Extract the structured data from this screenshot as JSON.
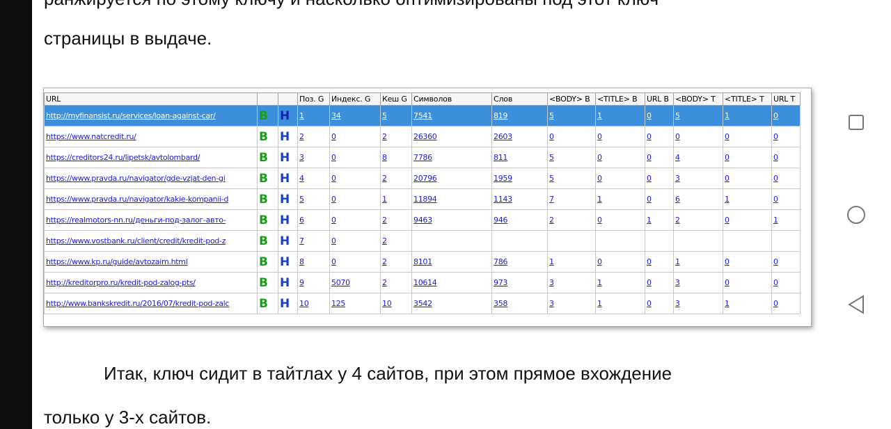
{
  "article": {
    "cut_line": "ранжируется по этому ключу и насколько оптимизированы под этот ключ",
    "line2": "страницы в выдаче.",
    "line3": "Итак, ключ сидит в тайтлах у 4 сайтов, при этом прямое вхождение",
    "line4": "только у 3-х сайтов."
  },
  "table": {
    "headers": [
      "URL",
      "",
      "",
      "Поз. G",
      "Индекс. G",
      "Кеш G",
      "Символов",
      "Слов",
      "<BODY> B",
      "<TITLE> B",
      "URL B",
      "<BODY> T",
      "<TITLE> T",
      "URL T"
    ],
    "yandex_label": "B",
    "google_label": "H",
    "rows": [
      {
        "url": "http://myfinansist.ru/services/loan-against-car/",
        "pos": "1",
        "idx": "34",
        "cache": "5",
        "chars": "7541",
        "words": "819",
        "body_b": "5",
        "title_b": "1",
        "url_b": "0",
        "body_t": "5",
        "title_t": "1",
        "url_t": "0"
      },
      {
        "url": "https://www.natcredit.ru/",
        "pos": "2",
        "idx": "0",
        "cache": "2",
        "chars": "26360",
        "words": "2603",
        "body_b": "0",
        "title_b": "0",
        "url_b": "0",
        "body_t": "0",
        "title_t": "0",
        "url_t": "0"
      },
      {
        "url": "https://creditors24.ru/lipetsk/avtolombard/",
        "pos": "3",
        "idx": "0",
        "cache": "8",
        "chars": "7786",
        "words": "811",
        "body_b": "5",
        "title_b": "0",
        "url_b": "0",
        "body_t": "4",
        "title_t": "0",
        "url_t": "0"
      },
      {
        "url": "https://www.pravda.ru/navigator/gde-vzjat-den-gi",
        "pos": "4",
        "idx": "0",
        "cache": "2",
        "chars": "20796",
        "words": "1959",
        "body_b": "5",
        "title_b": "0",
        "url_b": "0",
        "body_t": "3",
        "title_t": "0",
        "url_t": "0"
      },
      {
        "url": "https://www.pravda.ru/navigator/kakie-kompanii-d",
        "pos": "5",
        "idx": "0",
        "cache": "1",
        "chars": "11894",
        "words": "1143",
        "body_b": "7",
        "title_b": "1",
        "url_b": "0",
        "body_t": "6",
        "title_t": "1",
        "url_t": "0"
      },
      {
        "url": "https://realmotors-nn.ru/деньги-под-залог-авто-",
        "pos": "6",
        "idx": "0",
        "cache": "2",
        "chars": "9463",
        "words": "946",
        "body_b": "2",
        "title_b": "0",
        "url_b": "1",
        "body_t": "2",
        "title_t": "0",
        "url_t": "1"
      },
      {
        "url": "https://www.vostbank.ru/client/credit/kredit-pod-z",
        "pos": "7",
        "idx": "0",
        "cache": "2",
        "chars": "",
        "words": "",
        "body_b": "",
        "title_b": "",
        "url_b": "",
        "body_t": "",
        "title_t": "",
        "url_t": ""
      },
      {
        "url": "https://www.kp.ru/guide/avtozaim.html",
        "pos": "8",
        "idx": "0",
        "cache": "2",
        "chars": "8101",
        "words": "786",
        "body_b": "1",
        "title_b": "0",
        "url_b": "0",
        "body_t": "1",
        "title_t": "0",
        "url_t": "0"
      },
      {
        "url": "http://kreditorpro.ru/kredit-pod-zalog-pts/",
        "pos": "9",
        "idx": "5070",
        "cache": "2",
        "chars": "10614",
        "words": "973",
        "body_b": "3",
        "title_b": "1",
        "url_b": "0",
        "body_t": "3",
        "title_t": "0",
        "url_t": "0"
      },
      {
        "url": "http://www.bankskredit.ru/2016/07/kredit-pod-zalc",
        "pos": "10",
        "idx": "125",
        "cache": "10",
        "chars": "3542",
        "words": "358",
        "body_b": "3",
        "title_b": "1",
        "url_b": "0",
        "body_t": "3",
        "title_t": "1",
        "url_t": "0"
      }
    ]
  },
  "nav": {
    "icons": [
      "recent-apps-icon",
      "home-icon",
      "back-icon"
    ],
    "color": "#777777"
  },
  "colors": {
    "selected_row": "#3d8fdb",
    "link": "#1a1adb",
    "yandex_green": "#1b9b1b",
    "google_blue": "#1a3fc4"
  }
}
